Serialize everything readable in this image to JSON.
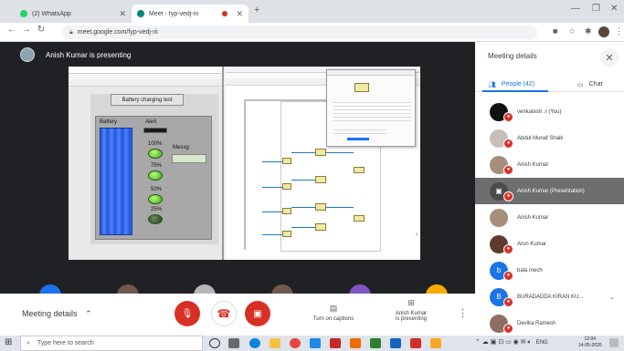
{
  "browser": {
    "tabs": [
      {
        "title": "(2) WhatsApp",
        "icon": "whatsapp-icon",
        "color": "#25d366"
      },
      {
        "title": "Meet - fyp-vedj-rii",
        "icon": "meet-icon",
        "color": "#00897b"
      }
    ],
    "url": "meet.google.com/fyp-vedj-rii"
  },
  "presenter": {
    "label": "Anish Kumar is presenting"
  },
  "shared_screen": {
    "battery_button": "Battery charging test",
    "battery_label": "Battery",
    "alert_label": "Alert",
    "message_label": "Messg",
    "levels": [
      "100%",
      "75%",
      "50%",
      "25%"
    ]
  },
  "sidebar": {
    "title": "Meeting details",
    "tabs": {
      "people": "People (42)",
      "chat": "Chat"
    },
    "participants": [
      {
        "name": "venkatesh .r (You)",
        "avatar_color": "#111111",
        "initial": ""
      },
      {
        "name": "Abdul Munaf Shaik",
        "avatar_color": "#c7c0b8",
        "initial": ""
      },
      {
        "name": "Anish Kumar",
        "avatar_color": "#a38f7a",
        "initial": ""
      },
      {
        "name": "Anish Kumar (Presentation)",
        "avatar_color": "#4a4b4d",
        "initial": ""
      },
      {
        "name": "Anish Kumar",
        "avatar_color": "#a38f7a",
        "initial": ""
      },
      {
        "name": "Arun Kumar",
        "avatar_color": "#5c3b2e",
        "initial": ""
      },
      {
        "name": "bala mech",
        "avatar_color": "#1a73e8",
        "initial": "b"
      },
      {
        "name": "BURADADDA KIRAN KU...",
        "avatar_color": "#1a73e8",
        "initial": "B"
      },
      {
        "name": "Devika Ramesh",
        "avatar_color": "#8d6e63",
        "initial": ""
      }
    ]
  },
  "controls": {
    "meeting_details": "Meeting details",
    "captions": "Turn on captions",
    "presenting_line1": "Anish Kumar",
    "presenting_line2": "is presenting"
  },
  "taskbar": {
    "search_placeholder": "Type here to search",
    "lang": "ENG",
    "time": "12:04",
    "date": "14-05-2020"
  }
}
